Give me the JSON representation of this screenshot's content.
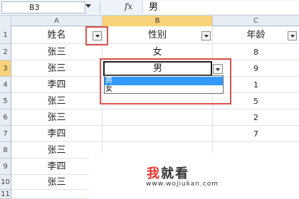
{
  "formula_bar": {
    "name_box": "B3",
    "fx_label": "fx",
    "formula": "男"
  },
  "columns": [
    "A",
    "B",
    "C"
  ],
  "rows": [
    "1",
    "2",
    "3",
    "4",
    "5",
    "6",
    "7",
    "8",
    "9",
    "10",
    "11"
  ],
  "headers": {
    "name": "姓名",
    "gender": "性别",
    "age": "年龄"
  },
  "data": [
    {
      "name": "张三",
      "gender": "女",
      "age": "8"
    },
    {
      "name": "张三",
      "gender": "男",
      "age": "9"
    },
    {
      "name": "李四",
      "gender": "",
      "age": "1"
    },
    {
      "name": "张三",
      "gender": "",
      "age": "5"
    },
    {
      "name": "张三",
      "gender": "",
      "age": "2"
    },
    {
      "name": "李四",
      "gender": "",
      "age": "7"
    },
    {
      "name": "张三",
      "gender": "",
      "age": ""
    },
    {
      "name": "李四",
      "gender": "",
      "age": ""
    },
    {
      "name": "张三",
      "gender": "",
      "age": ""
    },
    {
      "name": "",
      "gender": "",
      "age": ""
    }
  ],
  "dropdown": {
    "options": [
      "男",
      "女"
    ],
    "highlighted": "男"
  },
  "watermark": {
    "title_wo": "我",
    "title_rest": "就看",
    "url": "www.wojiukan.com"
  },
  "colors": {
    "annotation": "#d9534f",
    "selection": "#f8d37a",
    "dropdown_highlight": "#3399ff"
  }
}
